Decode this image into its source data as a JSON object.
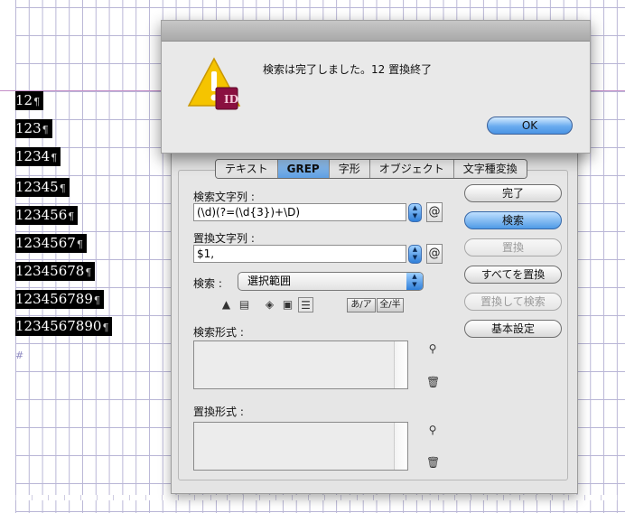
{
  "document": {
    "number_rows": [
      "12",
      "123",
      "1234",
      "12345",
      "123456",
      "1234567",
      "12345678",
      "123456789",
      "1234567890"
    ],
    "pilcrow": "¶",
    "hash_mark": "#"
  },
  "alert": {
    "message": "検索は完了しました。12 置換終了",
    "icon_badge": "ID",
    "ok_label": "OK",
    "icon": "warning-triangle-icon"
  },
  "find_change": {
    "tabs": [
      {
        "label": "テキスト",
        "active": false
      },
      {
        "label": "GREP",
        "active": true
      },
      {
        "label": "字形",
        "active": false
      },
      {
        "label": "オブジェクト",
        "active": false
      },
      {
        "label": "文字種変換",
        "active": false
      }
    ],
    "find_label": "検索文字列 :",
    "find_value": "(\\d)(?=(\\d{3})+\\D)",
    "change_label": "置換文字列 :",
    "change_value": "$1,",
    "at_symbol": "@",
    "search_label": "検索 :",
    "search_scope": "選択範囲",
    "kana_toggle": "あ/ア",
    "width_toggle": "全/半",
    "find_format_label": "検索形式 :",
    "change_format_label": "置換形式 :",
    "buttons": [
      {
        "label": "完了",
        "style": "normal"
      },
      {
        "label": "検索",
        "style": "blue"
      },
      {
        "label": "置換",
        "style": "disabled"
      },
      {
        "label": "すべてを置換",
        "style": "normal"
      },
      {
        "label": "置換して検索",
        "style": "disabled"
      },
      {
        "label": "基本設定",
        "style": "normal"
      }
    ]
  },
  "colors": {
    "accent_blue": "#5e9fe3",
    "warning_yellow": "#f5c400",
    "indesign_badge": "#8a1040"
  }
}
